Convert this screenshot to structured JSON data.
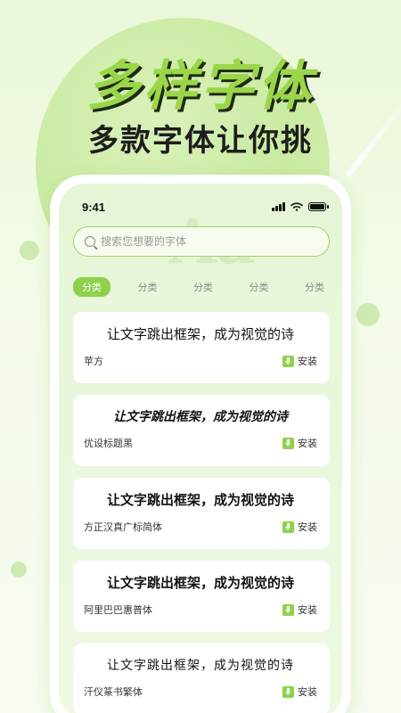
{
  "hero": {
    "title": "多样字体",
    "subtitle": "多款字体让你挑"
  },
  "status_bar": {
    "time": "9:41"
  },
  "watermark": "Aa",
  "search": {
    "placeholder": "搜索您想要的字体"
  },
  "tabs": [
    {
      "label": "分类",
      "active": true
    },
    {
      "label": "分类",
      "active": false
    },
    {
      "label": "分类",
      "active": false
    },
    {
      "label": "分类",
      "active": false
    },
    {
      "label": "分类",
      "active": false
    }
  ],
  "fonts": [
    {
      "sample": "让文字跳出框架，成为视觉的诗",
      "name": "苹方",
      "action": "安装"
    },
    {
      "sample": "让文字跳出框架，成为视觉的诗",
      "name": "优设标题黑",
      "action": "安装"
    },
    {
      "sample": "让文字跳出框架，成为视觉的诗",
      "name": "方正汉真广标简体",
      "action": "安装"
    },
    {
      "sample": "让文字跳出框架，成为视觉的诗",
      "name": "阿里巴巴惠普体",
      "action": "安装"
    },
    {
      "sample": "让文字跳出框架，成为视觉的诗",
      "name": "汗仪篆书繁体",
      "action": "安装"
    }
  ],
  "colors": {
    "accent": "#8fd14a",
    "background": "#eaf7d9"
  },
  "icons": {
    "search": "search-icon",
    "install": "download-icon",
    "signal": "signal-icon",
    "wifi": "wifi-icon",
    "battery": "battery-icon"
  }
}
